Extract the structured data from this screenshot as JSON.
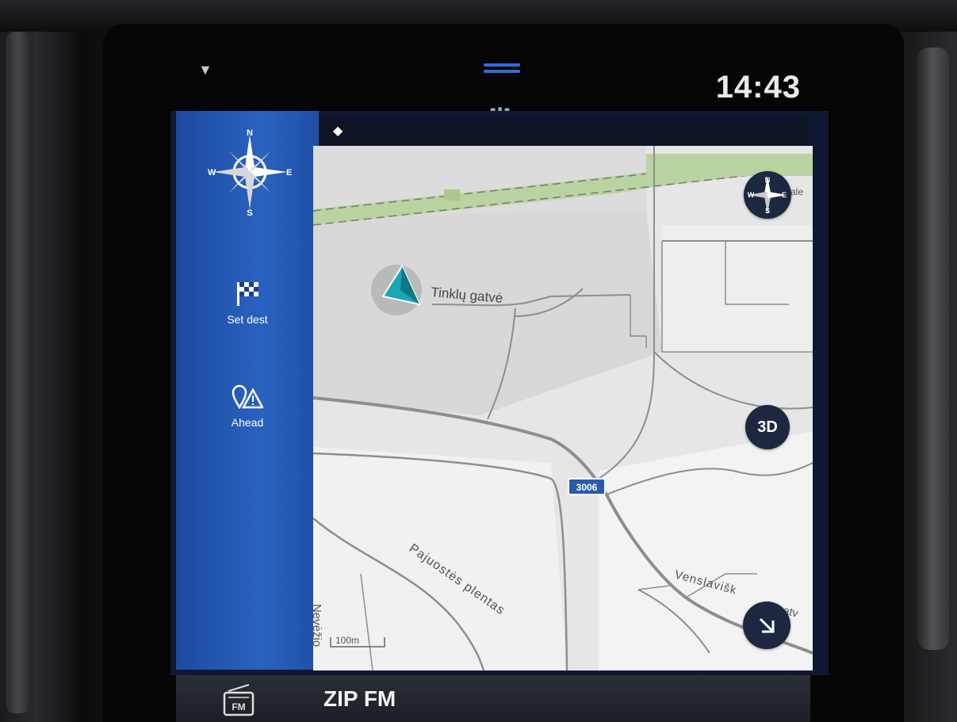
{
  "status": {
    "clock": "14:43"
  },
  "side": {
    "set_dest_label": "Set dest",
    "ahead_label": "Ahead",
    "compass_letters": {
      "n": "N",
      "e": "E",
      "s": "S",
      "w": "W"
    }
  },
  "map": {
    "streets": [
      "Tinklų gatvė",
      "Pajuostės plentas",
      "Venslavišk",
      "atv",
      "Nevėžio"
    ],
    "road_shield": "3006",
    "scale_label": "100m",
    "view_button": "3D",
    "compass_letters": {
      "n": "N",
      "e": "E",
      "s": "S",
      "w": "W"
    },
    "street_fragment_top_right": "ale"
  },
  "media": {
    "station": "ZIP FM",
    "icon_label": "FM"
  },
  "colors": {
    "panel_blue": "#2a62c0",
    "map_bg": "#e8e8e8",
    "park_green": "#b9d4a0",
    "vehicle_teal": "#1aa7b8",
    "button_dark": "#1d2740"
  }
}
